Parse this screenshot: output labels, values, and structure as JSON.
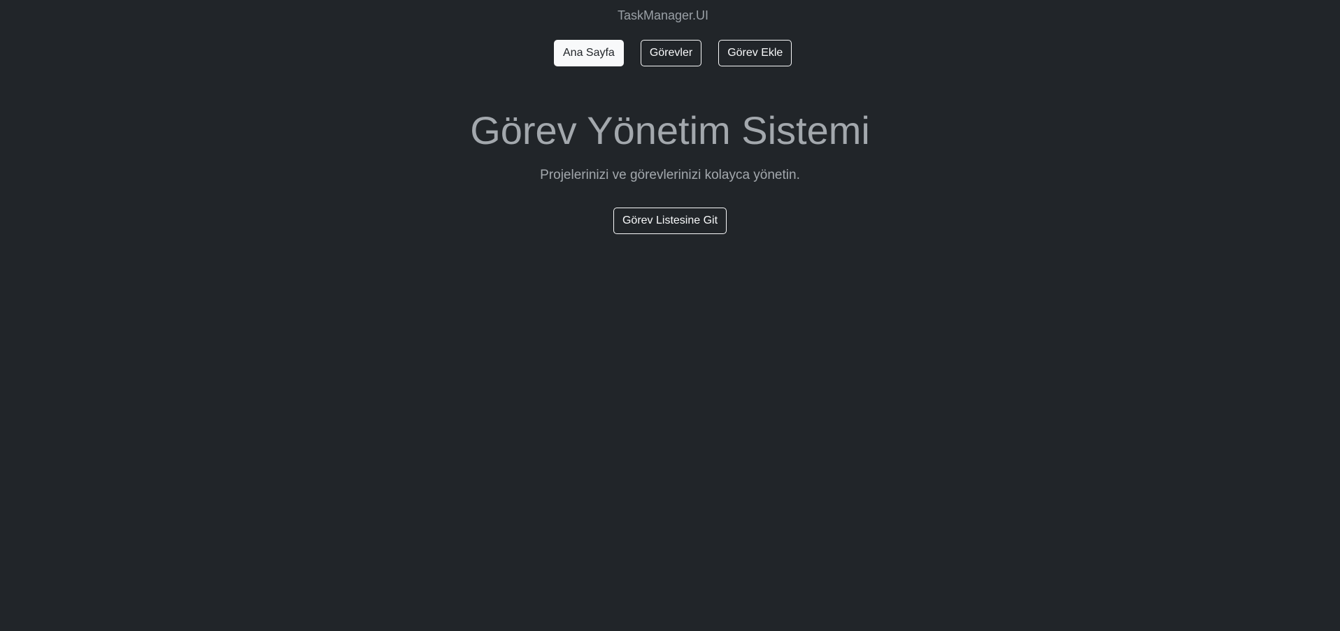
{
  "header": {
    "brand": "TaskManager.UI",
    "nav": [
      {
        "label": "Ana Sayfa",
        "active": true
      },
      {
        "label": "Görevler",
        "active": false
      },
      {
        "label": "Görev Ekle",
        "active": false
      }
    ]
  },
  "hero": {
    "title": "Görev Yönetim Sistemi",
    "subtitle": "Projelerinizi ve görevlerinizi kolayca yönetin.",
    "cta_label": "Görev Listesine Git"
  },
  "colors": {
    "background": "#212529",
    "button_border": "#f8f9fa",
    "muted_text": "#a3a8ad"
  }
}
